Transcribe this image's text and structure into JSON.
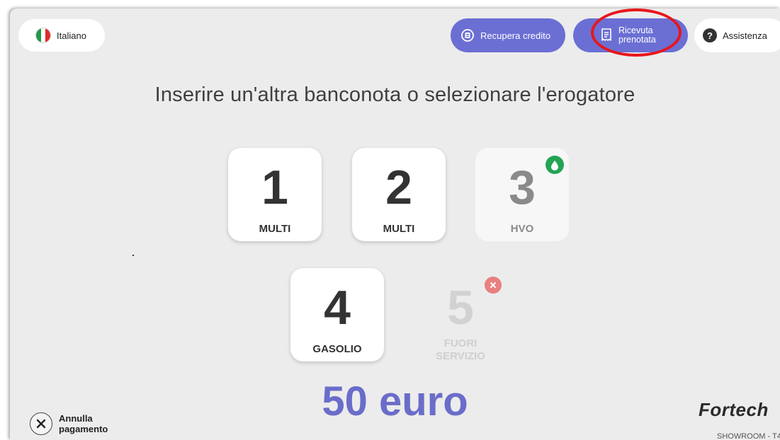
{
  "language": {
    "label": "Italiano",
    "flag_colors": [
      "#1f9a48",
      "#ffffff",
      "#e02a2a"
    ]
  },
  "header": {
    "recover_credit": "Recupera credito",
    "receipt_line1": "Ricevuta",
    "receipt_line2": "prenotata",
    "help": "Assistenza"
  },
  "instruction": "Inserire un'altra banconota o selezionare l'erogatore",
  "dispensers": [
    {
      "number": "1",
      "fuel": "MULTI"
    },
    {
      "number": "2",
      "fuel": "MULTI"
    },
    {
      "number": "3",
      "fuel": "HVO",
      "badge": "drop-icon"
    },
    {
      "number": "4",
      "fuel": "GASOLIO"
    },
    {
      "number": "5",
      "fuel_line1": "FUORI",
      "fuel_line2": "SERVIZIO",
      "badge": "error-icon",
      "status": "out-of-service"
    }
  ],
  "amount": "50 euro",
  "cancel": {
    "line1": "Annulla",
    "line2": "pagamento"
  },
  "brand": "Fortech",
  "station": "SHOWROOM - T4",
  "colors": {
    "accent": "#6b6fd4",
    "amount": "#6a6dc9",
    "ok_badge": "#23a455",
    "error_badge": "#e88080",
    "highlight": "#e8161b"
  }
}
